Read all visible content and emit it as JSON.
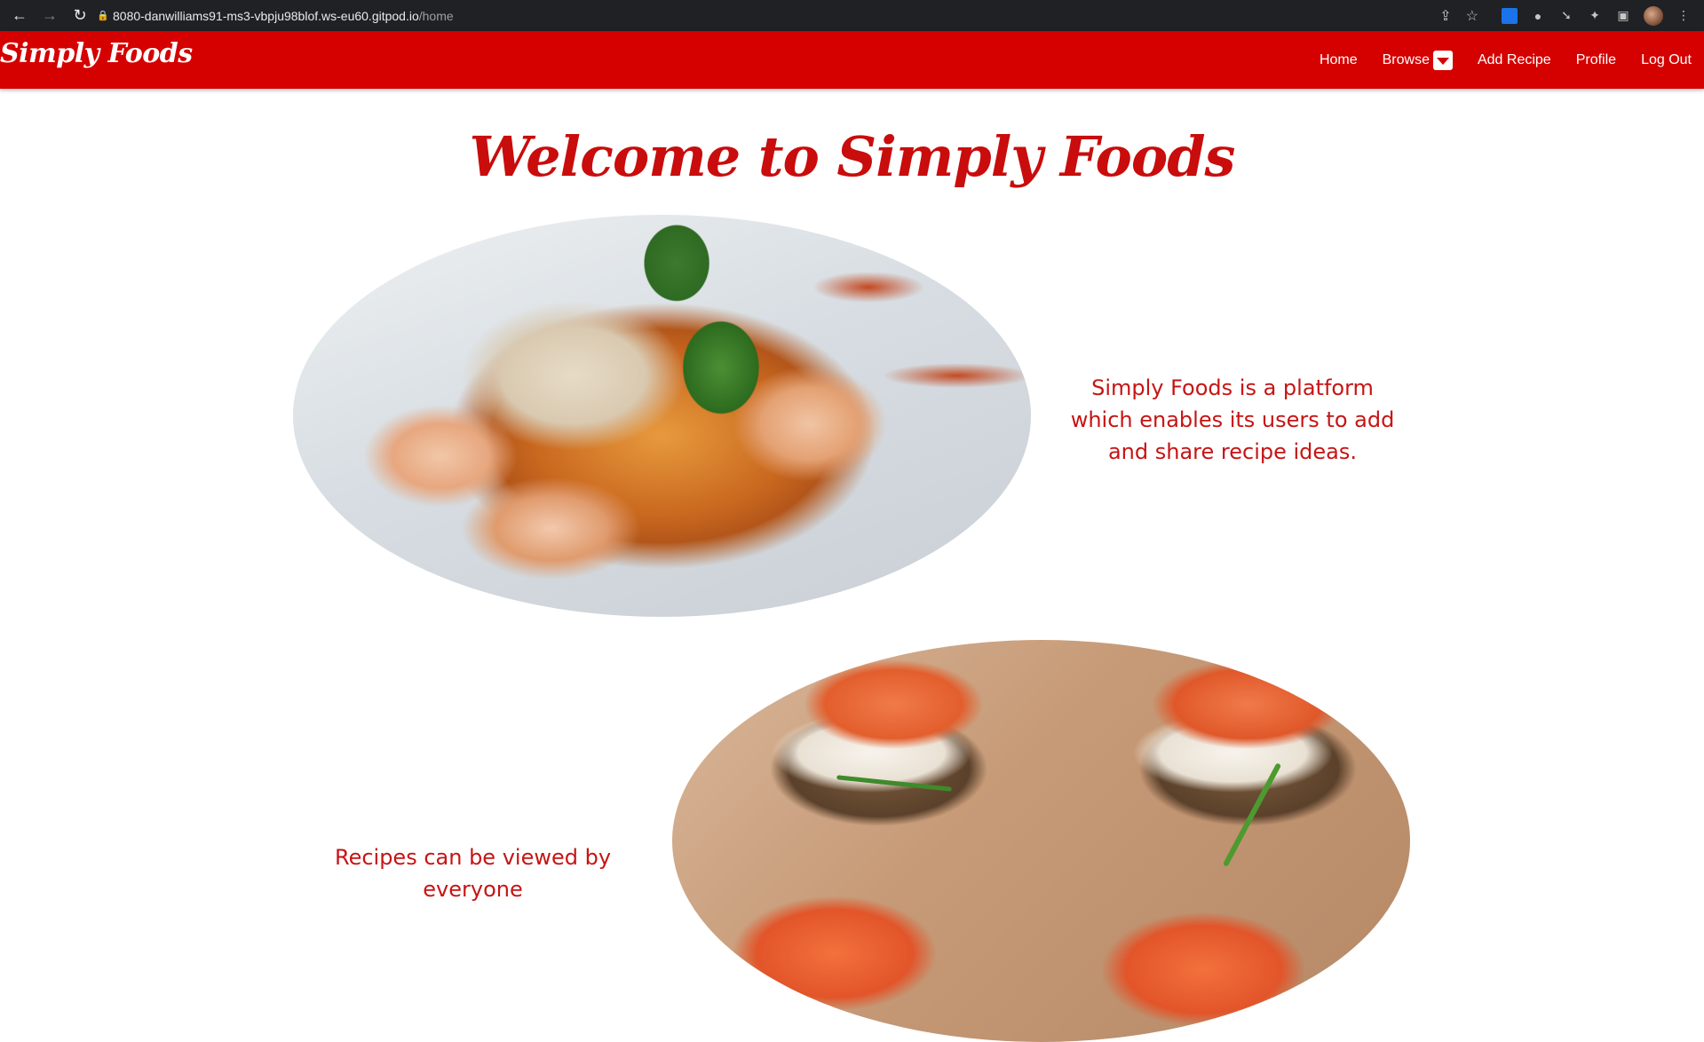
{
  "browser": {
    "url_host": "8080-danwilliams91-ms3-vbpju98blof.ws-eu60.gitpod.io",
    "url_path": "/home",
    "icons": {
      "back": "arrow-left-icon",
      "forward": "arrow-right-icon",
      "reload": "reload-icon",
      "lock": "lock-icon",
      "share": "share-icon",
      "bookmark": "star-icon",
      "extensions": "puzzle-icon",
      "side_panel": "side-panel-icon",
      "profile": "avatar",
      "menu": "kebab-menu-icon"
    }
  },
  "navbar": {
    "brand": "Simply Foods",
    "links": {
      "home": "Home",
      "browse": "Browse",
      "add_recipe": "Add Recipe",
      "profile": "Profile",
      "logout": "Log Out"
    },
    "colors": {
      "background": "#d50000",
      "text": "#ffffff"
    }
  },
  "main": {
    "title": "Welcome to Simply Foods",
    "sections": [
      {
        "text": "Simply Foods is a platform which enables its users to add and share recipe ideas."
      },
      {
        "text": "Recipes can be viewed by everyone"
      }
    ],
    "colors": {
      "accent": "#c90c0c"
    }
  }
}
